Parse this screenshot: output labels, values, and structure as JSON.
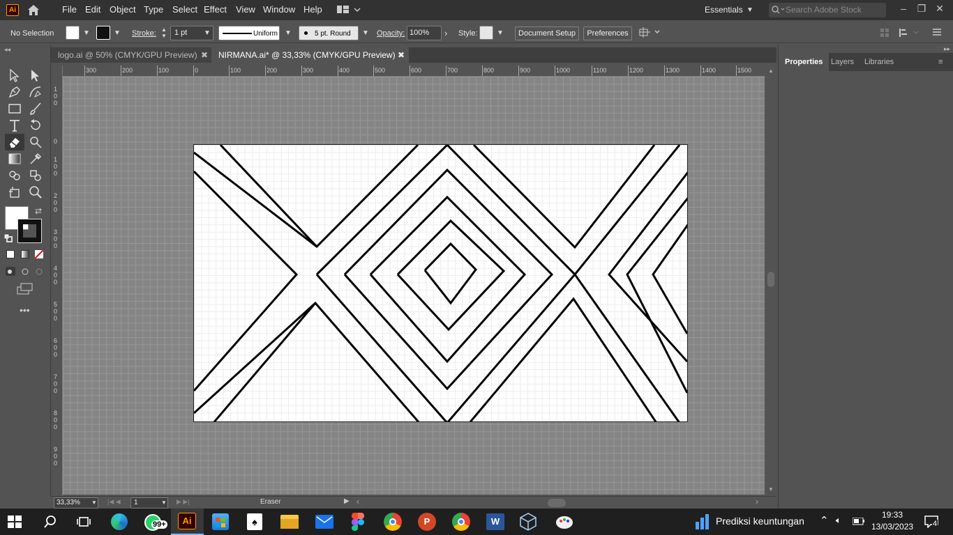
{
  "app": {
    "logo": "Ai",
    "workspace": "Essentials",
    "search_placeholder": "Search Adobe Stock"
  },
  "menu": [
    "File",
    "Edit",
    "Object",
    "Type",
    "Select",
    "Effect",
    "View",
    "Window",
    "Help"
  ],
  "control": {
    "selection": "No Selection",
    "stroke_label": "Stroke:",
    "stroke_value": "1 pt",
    "profile": "Uniform",
    "brush": "5 pt. Round",
    "opacity_label": "Opacity:",
    "opacity_value": "100%",
    "style_label": "Style:",
    "document_setup": "Document Setup",
    "preferences": "Preferences"
  },
  "tabs": [
    {
      "label": "logo.ai @ 50% (CMYK/GPU Preview)",
      "close": "✖"
    },
    {
      "label": "NIRMANA.ai* @ 33,33% (CMYK/GPU Preview)",
      "close": "✖"
    }
  ],
  "ruler": {
    "h": [
      "300",
      "200",
      "100",
      "0",
      "100",
      "200",
      "300",
      "400",
      "500",
      "600",
      "700",
      "800",
      "900",
      "1000",
      "1100",
      "1200",
      "1300",
      "1400",
      "1500"
    ],
    "v": [
      "1 0 0",
      "0",
      "1 0 0",
      "2 0 0",
      "3 0 0",
      "4 0 0",
      "5 0 0",
      "6 0 0",
      "7 0 0",
      "8 0 0",
      "9 0 0"
    ]
  },
  "panel": {
    "tabs": [
      "Properties",
      "Layers",
      "Libraries"
    ]
  },
  "status": {
    "zoom": "33,33%",
    "artboard": "1",
    "tool": "Eraser"
  },
  "taskbar": {
    "whatsapp_badge": "99+",
    "news": "Prediksi keuntungan",
    "time": "19:33",
    "date": "13/03/2023",
    "notif": "4"
  },
  "colors": {
    "accent": "#ff9a00",
    "ui_bg": "#535353",
    "menubar": "#323232",
    "taskbar": "#1f1f1f"
  }
}
